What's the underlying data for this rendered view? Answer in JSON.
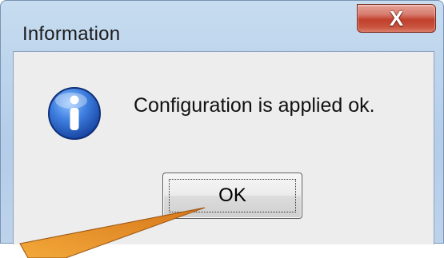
{
  "window": {
    "title": "Information",
    "close_glyph": "X"
  },
  "dialog": {
    "icon": "info-icon",
    "message": "Configuration is applied ok.",
    "ok_label": "OK"
  },
  "colors": {
    "close_button": "#c9543f",
    "arrow": "#e38a1c",
    "icon_blue": "#2a5fc2"
  }
}
